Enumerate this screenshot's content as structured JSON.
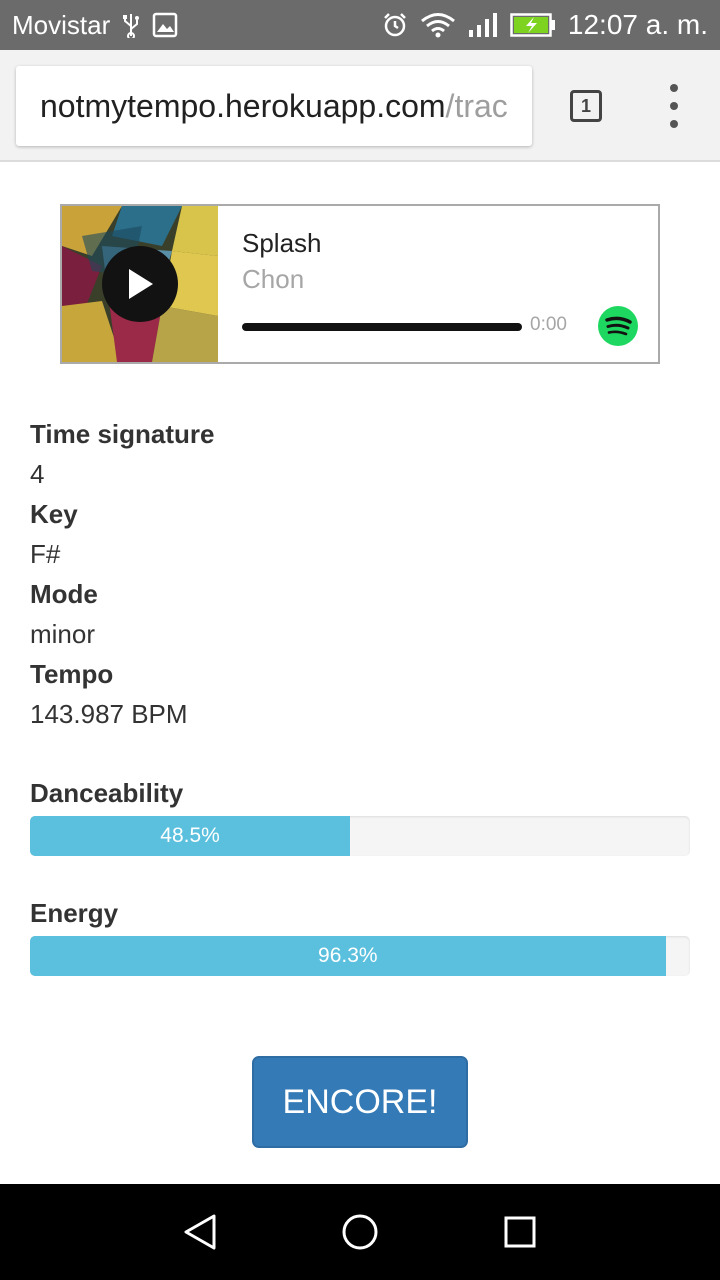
{
  "status_bar": {
    "carrier": "Movistar",
    "time": "12:07 a. m.",
    "icons": [
      "usb-icon",
      "image-icon",
      "alarm-icon",
      "wifi-icon",
      "signal-icon",
      "battery-charging-icon"
    ]
  },
  "browser": {
    "url_host": "notmytempo.herokuapp.com",
    "url_path": "/trac",
    "tab_count": "1"
  },
  "player": {
    "track_title": "Splash",
    "artist": "Chon",
    "elapsed": "0:00",
    "progress": 0,
    "icons": [
      "play-icon",
      "spotify-icon"
    ]
  },
  "info": {
    "time_signature_label": "Time signature",
    "time_signature_value": "4",
    "key_label": "Key",
    "key_value": "F#",
    "mode_label": "Mode",
    "mode_value": "minor",
    "tempo_label": "Tempo",
    "tempo_value": "143.987 BPM"
  },
  "metrics": {
    "danceability_label": "Danceability",
    "danceability_text": "48.5%",
    "danceability_percent": 48.5,
    "energy_label": "Energy",
    "energy_text": "96.3%",
    "energy_percent": 96.3
  },
  "button": {
    "encore_label": "ENCORE!"
  },
  "colors": {
    "bar_fill": "#5bc0de",
    "button": "#337ab7",
    "spotify_green": "#1ed760"
  }
}
